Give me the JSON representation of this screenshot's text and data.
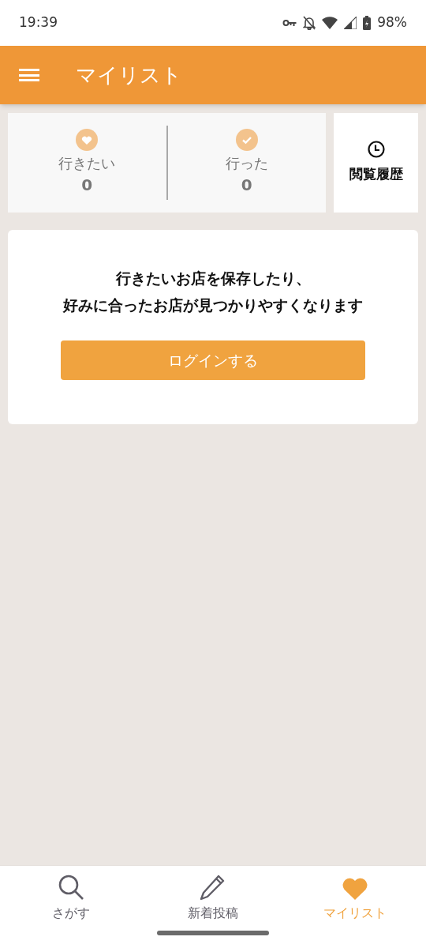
{
  "status_bar": {
    "time": "19:39",
    "battery": "98%"
  },
  "app_bar": {
    "title": "マイリスト"
  },
  "counters": [
    {
      "kind": "heart",
      "label": "行きたい",
      "count": "0"
    },
    {
      "kind": "check",
      "label": "行った",
      "count": "0"
    }
  ],
  "history_button": {
    "label": "閲覧履歴"
  },
  "login_card": {
    "message_lines": [
      "行きたいお店を保存したり、",
      "好みに合ったお店が見つかりやすくなります"
    ],
    "button": "ログインする"
  },
  "bottom_nav": [
    {
      "kind": "search",
      "label": "さがす",
      "selected": false
    },
    {
      "kind": "pencil",
      "label": "新着投稿",
      "selected": false
    },
    {
      "kind": "heart",
      "label": "マイリスト",
      "selected": true
    }
  ]
}
